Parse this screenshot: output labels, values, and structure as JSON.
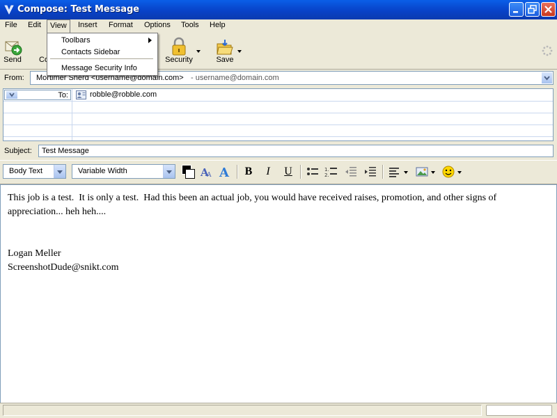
{
  "window": {
    "title": "Compose: Test Message"
  },
  "menubar": {
    "items": [
      "File",
      "Edit",
      "View",
      "Insert",
      "Format",
      "Options",
      "Tools",
      "Help"
    ]
  },
  "view_menu": {
    "items": [
      "Toolbars",
      "Contacts Sidebar",
      "Message Security Info"
    ]
  },
  "toolbar": {
    "send": "Send",
    "contacts_partial": "Co",
    "security": "Security",
    "save": "Save"
  },
  "header": {
    "from_label": "From:",
    "from_value": "Mortimer Snerd <username@domain.com>",
    "from_account": "- username@domain.com",
    "to_label": "To:",
    "to_value": "robble@robble.com",
    "subject_label": "Subject:",
    "subject_value": "Test Message"
  },
  "format_bar": {
    "paragraph_style": "Body Text",
    "font": "Variable Width",
    "bold": "B",
    "italic": "I",
    "underline": "U"
  },
  "body": {
    "lines": [
      "This job is a test.  It is only a test.  Had this been an actual job, you would have received raises, promotion, and other signs of",
      "appreciation... heh heh....",
      "Logan Meller",
      "ScreenshotDude@snikt.com"
    ]
  }
}
